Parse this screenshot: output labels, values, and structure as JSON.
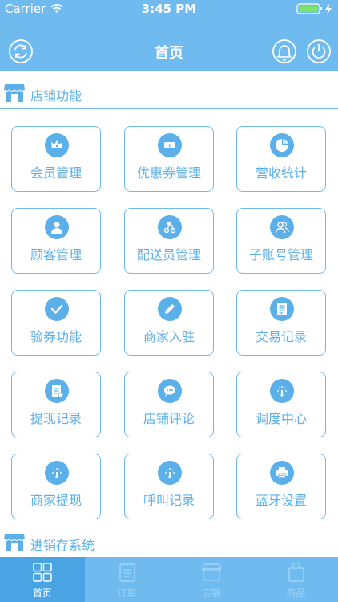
{
  "status": {
    "carrier": "Carrier",
    "time": "3:45 PM"
  },
  "nav": {
    "title": "首页"
  },
  "sections": {
    "store": "店铺功能",
    "inventory": "进销存系统"
  },
  "tiles": [
    {
      "label": "会员管理",
      "icon": "crown-icon"
    },
    {
      "label": "优惠券管理",
      "icon": "coupon-icon"
    },
    {
      "label": "营收统计",
      "icon": "pie-chart-icon"
    },
    {
      "label": "顾客管理",
      "icon": "user-icon"
    },
    {
      "label": "配送员管理",
      "icon": "courier-icon"
    },
    {
      "label": "子账号管理",
      "icon": "users-icon"
    },
    {
      "label": "验券功能",
      "icon": "check-icon"
    },
    {
      "label": "商家入驻",
      "icon": "pencil-icon"
    },
    {
      "label": "交易记录",
      "icon": "list-icon"
    },
    {
      "label": "提现记录",
      "icon": "withdraw-icon"
    },
    {
      "label": "店铺评论",
      "icon": "comment-icon"
    },
    {
      "label": "调度中心",
      "icon": "gauge-icon"
    },
    {
      "label": "商家提现",
      "icon": "gauge-icon"
    },
    {
      "label": "呼叫记录",
      "icon": "gauge-icon"
    },
    {
      "label": "蓝牙设置",
      "icon": "printer-icon"
    }
  ],
  "tabs": [
    {
      "label": "首页",
      "icon": "grid-icon",
      "active": true
    },
    {
      "label": "订单",
      "icon": "notepad-icon",
      "active": false
    },
    {
      "label": "店铺",
      "icon": "store-icon",
      "active": false
    },
    {
      "label": "商品",
      "icon": "bag-icon",
      "active": false
    }
  ],
  "colors": {
    "primary": "#6fbbf0",
    "accent": "#5bb0ea",
    "tab_active": "#4aa3e3"
  }
}
